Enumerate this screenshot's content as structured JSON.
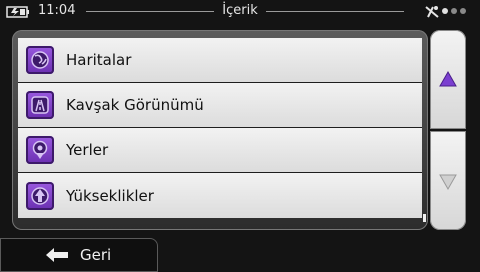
{
  "status": {
    "time": "11:04",
    "title": "İçerik",
    "battery_icon": "battery-icon",
    "gps_icon": "gps-icon",
    "page_indicator": {
      "count": 3,
      "active": 1
    }
  },
  "list": {
    "items": [
      {
        "label": "Haritalar",
        "icon": "maps-icon"
      },
      {
        "label": "Kavşak Görünümü",
        "icon": "junction-view-icon"
      },
      {
        "label": "Yerler",
        "icon": "places-icon"
      },
      {
        "label": "Yükseklikler",
        "icon": "elevations-icon"
      }
    ]
  },
  "scroll": {
    "up_icon": "triangle-up-icon",
    "down_icon": "triangle-down-icon",
    "up_color": "#7b3fd0",
    "down_color": "#b8b8b8"
  },
  "footer": {
    "back_label": "Geri",
    "back_icon": "arrow-left-icon"
  }
}
